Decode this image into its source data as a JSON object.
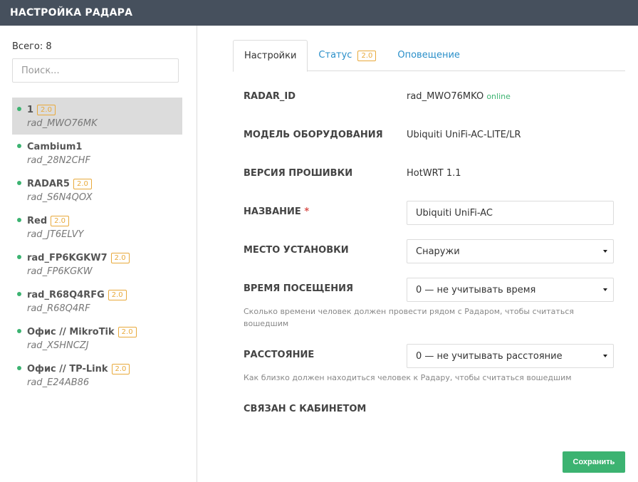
{
  "header": {
    "title": "НАСТРОЙКА РАДАРА"
  },
  "sidebar": {
    "total_label": "Всего: 8",
    "search_placeholder": "Поиск...",
    "items": [
      {
        "name": "1",
        "badge": "2.0",
        "id": "rad_MWO76MK",
        "active": true
      },
      {
        "name": "Cambium1",
        "badge": "",
        "id": "rad_28N2CHF"
      },
      {
        "name": "RADAR5",
        "badge": "2.0",
        "id": "rad_S6N4QOX"
      },
      {
        "name": "Red",
        "badge": "2.0",
        "id": "rad_JT6ELVY"
      },
      {
        "name": "rad_FP6KGKW7",
        "badge": "2.0",
        "id": "rad_FP6KGKW"
      },
      {
        "name": "rad_R68Q4RFG",
        "badge": "2.0",
        "id": "rad_R68Q4RF"
      },
      {
        "name": "Офис // MikroTik",
        "badge": "2.0",
        "id": "rad_XSHNCZJ"
      },
      {
        "name": "Офис // TP-Link",
        "badge": "2.0",
        "id": "rad_E24AB86"
      }
    ]
  },
  "tabs": [
    {
      "label": "Настройки",
      "active": true
    },
    {
      "label": "Статус",
      "badge": "2.0"
    },
    {
      "label": "Оповещение"
    }
  ],
  "form": {
    "radar_id": {
      "label": "RADAR_ID",
      "value": "rad_MWO76MKO",
      "status": "online"
    },
    "model": {
      "label": "МОДЕЛЬ ОБОРУДОВАНИЯ",
      "value": "Ubiquiti UniFi-AC-LITE/LR"
    },
    "firmware": {
      "label": "ВЕРСИЯ ПРОШИВКИ",
      "value": "HotWRT 1.1"
    },
    "name": {
      "label": "НАЗВАНИЕ",
      "required_mark": "*",
      "value": "Ubiquiti UniFi-AC"
    },
    "location": {
      "label": "МЕСТО УСТАНОВКИ",
      "value": "Снаружи"
    },
    "visit_time": {
      "label": "ВРЕМЯ ПОСЕЩЕНИЯ",
      "value": "0 — не учитывать время",
      "hint": "Сколько времени человек должен провести рядом с Радаром, чтобы считаться вошедшим"
    },
    "distance": {
      "label": "РАССТОЯНИЕ",
      "value": "0 — не учитывать расстояние",
      "hint": "Как близко должен находиться человек к Радару, чтобы считаться вошедшим"
    },
    "cabinet": {
      "label": "СВЯЗАН С КАБИНЕТОМ"
    }
  },
  "actions": {
    "save_label": "Сохранить"
  },
  "colors": {
    "header_bg": "#46505d",
    "accent_green": "#3cb371",
    "badge_orange": "#e8a93b",
    "link_blue": "#2a8fc9"
  }
}
